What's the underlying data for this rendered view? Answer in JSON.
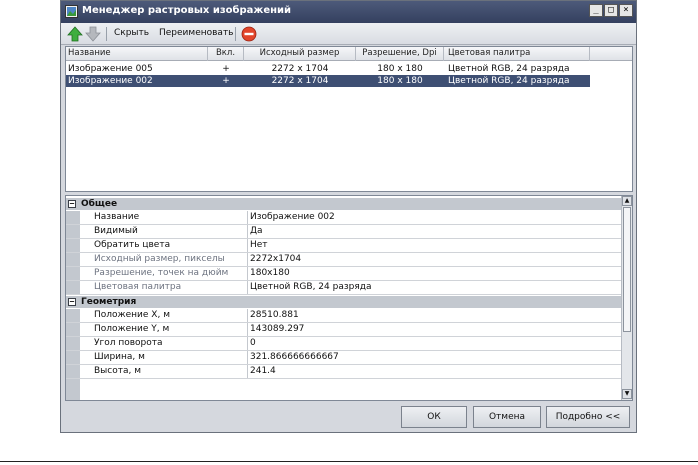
{
  "window": {
    "title": "Менеджер растровых изображений",
    "buttons": {
      "minimize": "_",
      "maximize": "□",
      "close": "×"
    }
  },
  "toolbar": {
    "hide_label": "Скрыть",
    "rename_label": "Переименовать",
    "icons": [
      "arrow-up-icon",
      "arrow-down-icon",
      "no-entry-icon"
    ]
  },
  "list": {
    "columns": [
      "Название",
      "Вкл.",
      "Исходный размер",
      "Разрешение, Dpi",
      "Цветовая палитра"
    ],
    "rows": [
      {
        "name": "Изображение 005",
        "on": "+",
        "size": "2272 x 1704",
        "dpi": "180 x 180",
        "palette": "Цветной RGB, 24 разряда",
        "selected": false
      },
      {
        "name": "Изображение 002",
        "on": "+",
        "size": "2272 x 1704",
        "dpi": "180 x 180",
        "palette": "Цветной RGB, 24 разряда",
        "selected": true
      }
    ]
  },
  "properties": {
    "general": {
      "title": "Общее",
      "toggle": "−",
      "rows": [
        {
          "name": "Название",
          "value": "Изображение 002",
          "readonly": false
        },
        {
          "name": "Видимый",
          "value": "Да",
          "readonly": false
        },
        {
          "name": "Обратить цвета",
          "value": "Нет",
          "readonly": false
        },
        {
          "name": "Исходный размер, пикселы",
          "value": "2272x1704",
          "readonly": true
        },
        {
          "name": "Разрешение, точек на дюйм",
          "value": "180x180",
          "readonly": true
        },
        {
          "name": "Цветовая палитра",
          "value": "Цветной RGB, 24 разряда",
          "readonly": true
        }
      ]
    },
    "geometry": {
      "title": "Геометрия",
      "toggle": "−",
      "rows": [
        {
          "name": "Положение X, м",
          "value": "28510.881",
          "readonly": false
        },
        {
          "name": "Положение Y, м",
          "value": "143089.297",
          "readonly": false
        },
        {
          "name": "Угол поворота",
          "value": "0",
          "readonly": false
        },
        {
          "name": "Ширина, м",
          "value": "321.866666666667",
          "readonly": false
        },
        {
          "name": "Высота, м",
          "value": "241.4",
          "readonly": false
        }
      ]
    }
  },
  "scrollbar": {
    "up": "▲",
    "down": "▼"
  },
  "footer": {
    "ok_label": "ОК",
    "cancel_label": "Отмена",
    "details_label": "Подробно <<"
  }
}
